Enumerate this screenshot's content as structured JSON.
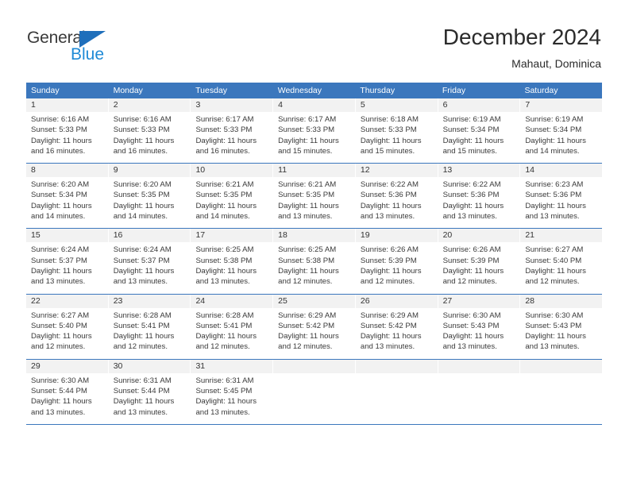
{
  "brand": {
    "name_part1": "General",
    "name_part2": "Blue",
    "triangle_icon": "triangle-icon",
    "color_dark": "#3a3a3a",
    "color_blue": "#1f8ad6",
    "color_triangle": "#1f6fbb"
  },
  "header": {
    "title": "December 2024",
    "subtitle": "Mahaut, Dominica"
  },
  "theme": {
    "header_row_bg": "#3b77bd",
    "day_number_bg": "#f2f2f2",
    "cell_bg": "#ffffff",
    "text_color": "#3a3a3a"
  },
  "weekdays": [
    "Sunday",
    "Monday",
    "Tuesday",
    "Wednesday",
    "Thursday",
    "Friday",
    "Saturday"
  ],
  "weeks": [
    {
      "days": [
        {
          "number": "1",
          "sunrise": "Sunrise: 6:16 AM",
          "sunset": "Sunset: 5:33 PM",
          "daylight_line1": "Daylight: 11 hours",
          "daylight_line2": "and 16 minutes."
        },
        {
          "number": "2",
          "sunrise": "Sunrise: 6:16 AM",
          "sunset": "Sunset: 5:33 PM",
          "daylight_line1": "Daylight: 11 hours",
          "daylight_line2": "and 16 minutes."
        },
        {
          "number": "3",
          "sunrise": "Sunrise: 6:17 AM",
          "sunset": "Sunset: 5:33 PM",
          "daylight_line1": "Daylight: 11 hours",
          "daylight_line2": "and 16 minutes."
        },
        {
          "number": "4",
          "sunrise": "Sunrise: 6:17 AM",
          "sunset": "Sunset: 5:33 PM",
          "daylight_line1": "Daylight: 11 hours",
          "daylight_line2": "and 15 minutes."
        },
        {
          "number": "5",
          "sunrise": "Sunrise: 6:18 AM",
          "sunset": "Sunset: 5:33 PM",
          "daylight_line1": "Daylight: 11 hours",
          "daylight_line2": "and 15 minutes."
        },
        {
          "number": "6",
          "sunrise": "Sunrise: 6:19 AM",
          "sunset": "Sunset: 5:34 PM",
          "daylight_line1": "Daylight: 11 hours",
          "daylight_line2": "and 15 minutes."
        },
        {
          "number": "7",
          "sunrise": "Sunrise: 6:19 AM",
          "sunset": "Sunset: 5:34 PM",
          "daylight_line1": "Daylight: 11 hours",
          "daylight_line2": "and 14 minutes."
        }
      ]
    },
    {
      "days": [
        {
          "number": "8",
          "sunrise": "Sunrise: 6:20 AM",
          "sunset": "Sunset: 5:34 PM",
          "daylight_line1": "Daylight: 11 hours",
          "daylight_line2": "and 14 minutes."
        },
        {
          "number": "9",
          "sunrise": "Sunrise: 6:20 AM",
          "sunset": "Sunset: 5:35 PM",
          "daylight_line1": "Daylight: 11 hours",
          "daylight_line2": "and 14 minutes."
        },
        {
          "number": "10",
          "sunrise": "Sunrise: 6:21 AM",
          "sunset": "Sunset: 5:35 PM",
          "daylight_line1": "Daylight: 11 hours",
          "daylight_line2": "and 14 minutes."
        },
        {
          "number": "11",
          "sunrise": "Sunrise: 6:21 AM",
          "sunset": "Sunset: 5:35 PM",
          "daylight_line1": "Daylight: 11 hours",
          "daylight_line2": "and 13 minutes."
        },
        {
          "number": "12",
          "sunrise": "Sunrise: 6:22 AM",
          "sunset": "Sunset: 5:36 PM",
          "daylight_line1": "Daylight: 11 hours",
          "daylight_line2": "and 13 minutes."
        },
        {
          "number": "13",
          "sunrise": "Sunrise: 6:22 AM",
          "sunset": "Sunset: 5:36 PM",
          "daylight_line1": "Daylight: 11 hours",
          "daylight_line2": "and 13 minutes."
        },
        {
          "number": "14",
          "sunrise": "Sunrise: 6:23 AM",
          "sunset": "Sunset: 5:36 PM",
          "daylight_line1": "Daylight: 11 hours",
          "daylight_line2": "and 13 minutes."
        }
      ]
    },
    {
      "days": [
        {
          "number": "15",
          "sunrise": "Sunrise: 6:24 AM",
          "sunset": "Sunset: 5:37 PM",
          "daylight_line1": "Daylight: 11 hours",
          "daylight_line2": "and 13 minutes."
        },
        {
          "number": "16",
          "sunrise": "Sunrise: 6:24 AM",
          "sunset": "Sunset: 5:37 PM",
          "daylight_line1": "Daylight: 11 hours",
          "daylight_line2": "and 13 minutes."
        },
        {
          "number": "17",
          "sunrise": "Sunrise: 6:25 AM",
          "sunset": "Sunset: 5:38 PM",
          "daylight_line1": "Daylight: 11 hours",
          "daylight_line2": "and 13 minutes."
        },
        {
          "number": "18",
          "sunrise": "Sunrise: 6:25 AM",
          "sunset": "Sunset: 5:38 PM",
          "daylight_line1": "Daylight: 11 hours",
          "daylight_line2": "and 12 minutes."
        },
        {
          "number": "19",
          "sunrise": "Sunrise: 6:26 AM",
          "sunset": "Sunset: 5:39 PM",
          "daylight_line1": "Daylight: 11 hours",
          "daylight_line2": "and 12 minutes."
        },
        {
          "number": "20",
          "sunrise": "Sunrise: 6:26 AM",
          "sunset": "Sunset: 5:39 PM",
          "daylight_line1": "Daylight: 11 hours",
          "daylight_line2": "and 12 minutes."
        },
        {
          "number": "21",
          "sunrise": "Sunrise: 6:27 AM",
          "sunset": "Sunset: 5:40 PM",
          "daylight_line1": "Daylight: 11 hours",
          "daylight_line2": "and 12 minutes."
        }
      ]
    },
    {
      "days": [
        {
          "number": "22",
          "sunrise": "Sunrise: 6:27 AM",
          "sunset": "Sunset: 5:40 PM",
          "daylight_line1": "Daylight: 11 hours",
          "daylight_line2": "and 12 minutes."
        },
        {
          "number": "23",
          "sunrise": "Sunrise: 6:28 AM",
          "sunset": "Sunset: 5:41 PM",
          "daylight_line1": "Daylight: 11 hours",
          "daylight_line2": "and 12 minutes."
        },
        {
          "number": "24",
          "sunrise": "Sunrise: 6:28 AM",
          "sunset": "Sunset: 5:41 PM",
          "daylight_line1": "Daylight: 11 hours",
          "daylight_line2": "and 12 minutes."
        },
        {
          "number": "25",
          "sunrise": "Sunrise: 6:29 AM",
          "sunset": "Sunset: 5:42 PM",
          "daylight_line1": "Daylight: 11 hours",
          "daylight_line2": "and 12 minutes."
        },
        {
          "number": "26",
          "sunrise": "Sunrise: 6:29 AM",
          "sunset": "Sunset: 5:42 PM",
          "daylight_line1": "Daylight: 11 hours",
          "daylight_line2": "and 13 minutes."
        },
        {
          "number": "27",
          "sunrise": "Sunrise: 6:30 AM",
          "sunset": "Sunset: 5:43 PM",
          "daylight_line1": "Daylight: 11 hours",
          "daylight_line2": "and 13 minutes."
        },
        {
          "number": "28",
          "sunrise": "Sunrise: 6:30 AM",
          "sunset": "Sunset: 5:43 PM",
          "daylight_line1": "Daylight: 11 hours",
          "daylight_line2": "and 13 minutes."
        }
      ]
    },
    {
      "days": [
        {
          "number": "29",
          "sunrise": "Sunrise: 6:30 AM",
          "sunset": "Sunset: 5:44 PM",
          "daylight_line1": "Daylight: 11 hours",
          "daylight_line2": "and 13 minutes."
        },
        {
          "number": "30",
          "sunrise": "Sunrise: 6:31 AM",
          "sunset": "Sunset: 5:44 PM",
          "daylight_line1": "Daylight: 11 hours",
          "daylight_line2": "and 13 minutes."
        },
        {
          "number": "31",
          "sunrise": "Sunrise: 6:31 AM",
          "sunset": "Sunset: 5:45 PM",
          "daylight_line1": "Daylight: 11 hours",
          "daylight_line2": "and 13 minutes."
        },
        {
          "number": "",
          "sunrise": "",
          "sunset": "",
          "daylight_line1": "",
          "daylight_line2": ""
        },
        {
          "number": "",
          "sunrise": "",
          "sunset": "",
          "daylight_line1": "",
          "daylight_line2": ""
        },
        {
          "number": "",
          "sunrise": "",
          "sunset": "",
          "daylight_line1": "",
          "daylight_line2": ""
        },
        {
          "number": "",
          "sunrise": "",
          "sunset": "",
          "daylight_line1": "",
          "daylight_line2": ""
        }
      ]
    }
  ]
}
